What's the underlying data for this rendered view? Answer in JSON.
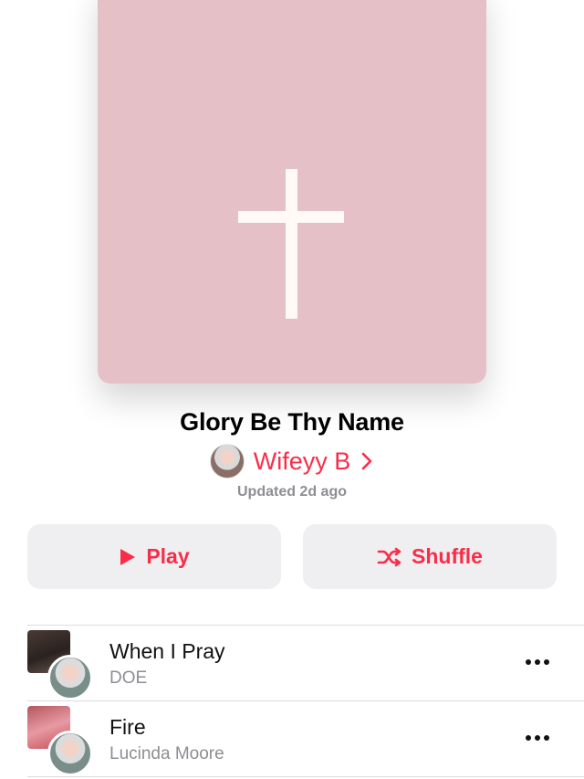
{
  "playlist": {
    "title": "Glory Be Thy Name",
    "curator": "Wifeyy B",
    "updated": "Updated 2d ago",
    "artwork_color": "#e5c1c7"
  },
  "actions": {
    "play_label": "Play",
    "shuffle_label": "Shuffle"
  },
  "accent_color": "#fa2d48",
  "tracks": [
    {
      "title": "When I Pray",
      "artist": "DOE",
      "icon": "more-icon"
    },
    {
      "title": "Fire",
      "artist": "Lucinda Moore",
      "icon": "more-icon"
    }
  ]
}
